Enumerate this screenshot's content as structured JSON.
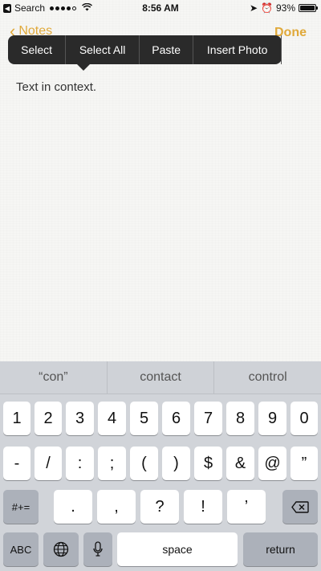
{
  "status_bar": {
    "back_app": "Search",
    "signal_dots_filled": 4,
    "signal_dots_total": 5,
    "time": "8:56 AM",
    "battery_percent": "93%",
    "battery_level": 0.93
  },
  "nav": {
    "back_label": "Notes",
    "done_label": "Done"
  },
  "edit_menu": {
    "items": [
      "Select",
      "Select All",
      "Paste",
      "Insert Photo"
    ]
  },
  "note": {
    "text": "Text in context."
  },
  "keyboard": {
    "predictions": [
      "“con”",
      "contact",
      "control"
    ],
    "row1": [
      "1",
      "2",
      "3",
      "4",
      "5",
      "6",
      "7",
      "8",
      "9",
      "0"
    ],
    "row2": [
      "-",
      "/",
      ":",
      ";",
      "(",
      ")",
      "$",
      "&",
      "@",
      "”"
    ],
    "row3_left": "#+=",
    "row3": [
      ".",
      ",",
      "?",
      "!",
      "’"
    ],
    "row4_abc": "ABC",
    "space": "space",
    "return": "return"
  }
}
